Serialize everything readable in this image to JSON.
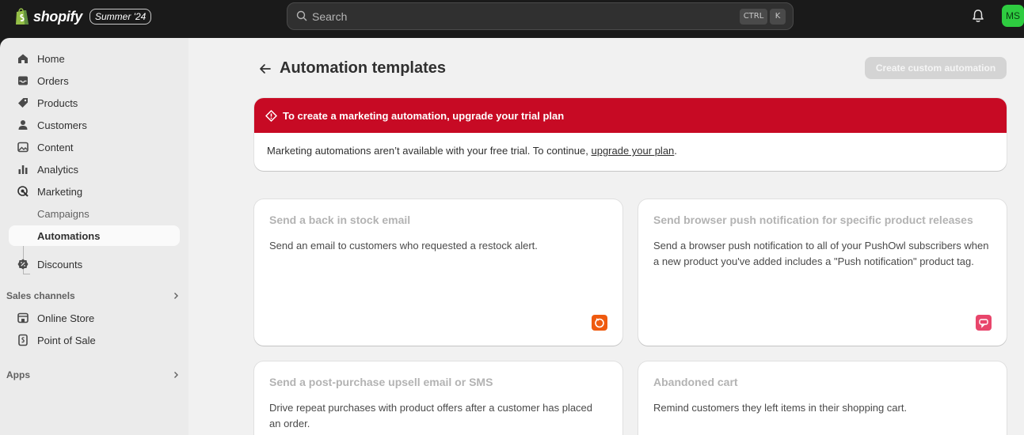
{
  "topbar": {
    "brand": "shopify",
    "edition": "Summer '24",
    "search_placeholder": "Search",
    "shortcut_ctrl": "CTRL",
    "shortcut_k": "K",
    "avatar_initials": "MS",
    "avatar_color": "#2ecc40"
  },
  "sidebar": {
    "items": [
      {
        "label": "Home",
        "icon": "home-icon"
      },
      {
        "label": "Orders",
        "icon": "inbox-icon"
      },
      {
        "label": "Products",
        "icon": "tag-icon"
      },
      {
        "label": "Customers",
        "icon": "person-icon"
      },
      {
        "label": "Content",
        "icon": "image-icon"
      },
      {
        "label": "Analytics",
        "icon": "bar-chart-icon"
      },
      {
        "label": "Marketing",
        "icon": "target-icon"
      },
      {
        "label": "Campaigns"
      },
      {
        "label": "Automations",
        "active": true
      },
      {
        "label": "Discounts",
        "icon": "discount-icon"
      }
    ],
    "sales_channels_title": "Sales channels",
    "sales_channels": [
      {
        "label": "Online Store",
        "icon": "store-icon"
      },
      {
        "label": "Point of Sale",
        "icon": "pos-icon"
      }
    ],
    "apps_title": "Apps"
  },
  "main": {
    "title": "Automation templates",
    "create_button": "Create custom automation",
    "banner": {
      "title": "To create a marketing automation, upgrade your trial plan",
      "text_before": "Marketing automations aren’t available with your free trial. To continue, ",
      "link": "upgrade your plan",
      "text_after": ".",
      "color": "#c70a24"
    },
    "cards": [
      {
        "title": "Send a back in stock email",
        "description": "Send an email to customers who requested a restock alert.",
        "app_icon": "restock-app-icon",
        "app_color": "#ef5a0f"
      },
      {
        "title": "Send browser push notification for specific product releases",
        "description": "Send a browser push notification to all of your PushOwl subscribers when a new product you've added includes a \"Push notification\" product tag.",
        "app_icon": "pushowl-app-icon",
        "app_color": "#e8456b"
      },
      {
        "title": "Send a post-purchase upsell email or SMS",
        "description": "Drive repeat purchases with product offers after a customer has placed an order."
      },
      {
        "title": "Abandoned cart",
        "description": "Remind customers they left items in their shopping cart."
      }
    ]
  }
}
